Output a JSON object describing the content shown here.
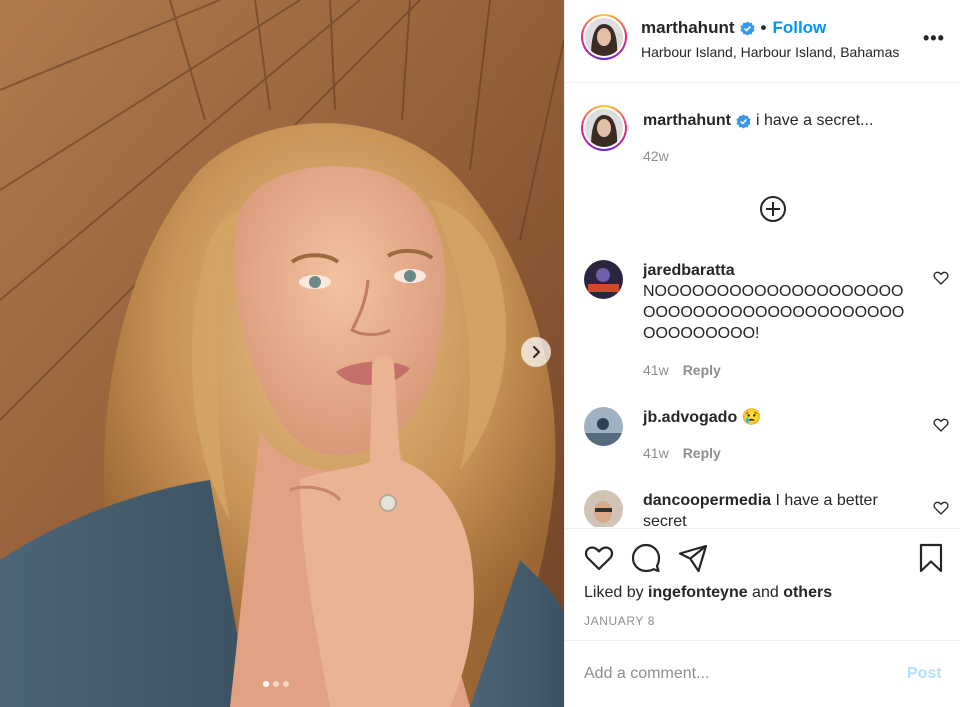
{
  "post": {
    "username": "marthahunt",
    "follow_label": "Follow",
    "separator": "•",
    "location": "Harbour Island, Harbour Island, Bahamas",
    "more_glyph": "•••",
    "caption": "i have a secret...",
    "caption_age": "42w",
    "likes_prefix": "Liked by ",
    "likes_user": "ingefonteyne",
    "likes_and": " and ",
    "likes_others": "others",
    "date": "JANUARY 8",
    "carousel_pages": 3,
    "carousel_current": 1
  },
  "comments": [
    {
      "user": "jaredbaratta",
      "text": "NOOOOOOOOOOOOOOOOOOOOOOOOOOOOOOOOOOOOOOOOOOOOOOOOOO!",
      "age": "41w",
      "reply": "Reply"
    },
    {
      "user": "jb.advogado",
      "text": "😢",
      "age": "41w",
      "reply": "Reply"
    },
    {
      "user": "dancoopermedia",
      "text": "I have a better secret"
    }
  ],
  "add_comment": {
    "placeholder": "Add a comment...",
    "post_label": "Post"
  },
  "colors": {
    "accent": "#0095f6",
    "verified": "#3897f0",
    "muted": "#8e8e8e",
    "post_disabled": "#b2dffc"
  },
  "icons": [
    "verified-badge-icon",
    "more-options-icon",
    "load-more-comments-icon",
    "heart-icon",
    "comment-icon",
    "share-icon",
    "bookmark-icon",
    "chevron-right-icon"
  ]
}
